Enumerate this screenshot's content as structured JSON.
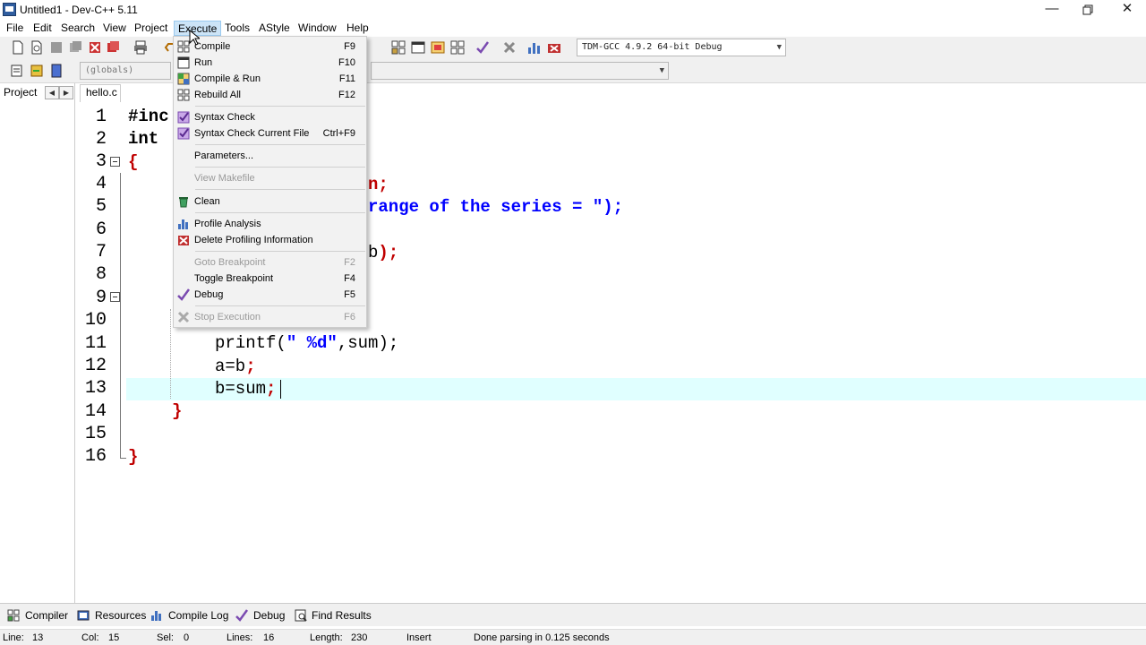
{
  "window": {
    "title": "Untitled1 - Dev-C++ 5.11"
  },
  "menubar": {
    "items": [
      "File",
      "Edit",
      "Search",
      "View",
      "Project",
      "Execute",
      "Tools",
      "AStyle",
      "Window",
      "Help"
    ],
    "active": "Execute"
  },
  "toolbar": {
    "compiler_select": "TDM-GCC 4.9.2 64-bit Debug",
    "scope_select": "(globals)"
  },
  "left_panel": {
    "tab": "Project"
  },
  "editor": {
    "file_tab": "hello.c",
    "line_numbers": [
      "1",
      "2",
      "3",
      "4",
      "5",
      "6",
      "7",
      "8",
      "9",
      "10",
      "11",
      "12",
      "13",
      "14",
      "15",
      "16"
    ],
    "lines": {
      "l1": "#inc",
      "l2": "int",
      "l3": "{",
      "l4": "n;",
      "l5": "range of the series = \");",
      "l7_plain": "b",
      "l7_red": ");",
      "l11_a": "printf(",
      "l11_b": "\" %d\"",
      "l11_c": ",sum);",
      "l12_a": "a=b",
      "l12_b": ";",
      "l13_a": "b=sum",
      "l13_b": ";",
      "l14": "}",
      "l16": "}"
    }
  },
  "execute_menu": {
    "items": [
      {
        "label": "Compile",
        "shortcut": "F9"
      },
      {
        "label": "Run",
        "shortcut": "F10"
      },
      {
        "label": "Compile & Run",
        "shortcut": "F11"
      },
      {
        "label": "Rebuild All",
        "shortcut": "F12"
      },
      {
        "label": "Syntax Check",
        "shortcut": ""
      },
      {
        "label": "Syntax Check Current File",
        "shortcut": "Ctrl+F9"
      },
      {
        "label": "Parameters...",
        "shortcut": ""
      },
      {
        "label": "View Makefile",
        "shortcut": ""
      },
      {
        "label": "Clean",
        "shortcut": ""
      },
      {
        "label": "Profile Analysis",
        "shortcut": ""
      },
      {
        "label": "Delete Profiling Information",
        "shortcut": ""
      },
      {
        "label": "Goto Breakpoint",
        "shortcut": "F2"
      },
      {
        "label": "Toggle Breakpoint",
        "shortcut": "F4"
      },
      {
        "label": "Debug",
        "shortcut": "F5"
      },
      {
        "label": "Stop Execution",
        "shortcut": "F6"
      }
    ]
  },
  "bottom_tabs": [
    "Compiler",
    "Resources",
    "Compile Log",
    "Debug",
    "Find Results"
  ],
  "status": {
    "line": "Line:",
    "line_val": "13",
    "col": "Col:",
    "col_val": "15",
    "sel": "Sel:",
    "sel_val": "0",
    "lines": "Lines:",
    "lines_val": "16",
    "length": "Length:",
    "length_val": "230",
    "mode": "Insert",
    "message": "Done parsing in 0.125 seconds"
  },
  "colors": {
    "accent": "#cce4f7",
    "current_line": "#e0ffff",
    "code_red": "#c00000",
    "code_blue": "#0000ff"
  }
}
